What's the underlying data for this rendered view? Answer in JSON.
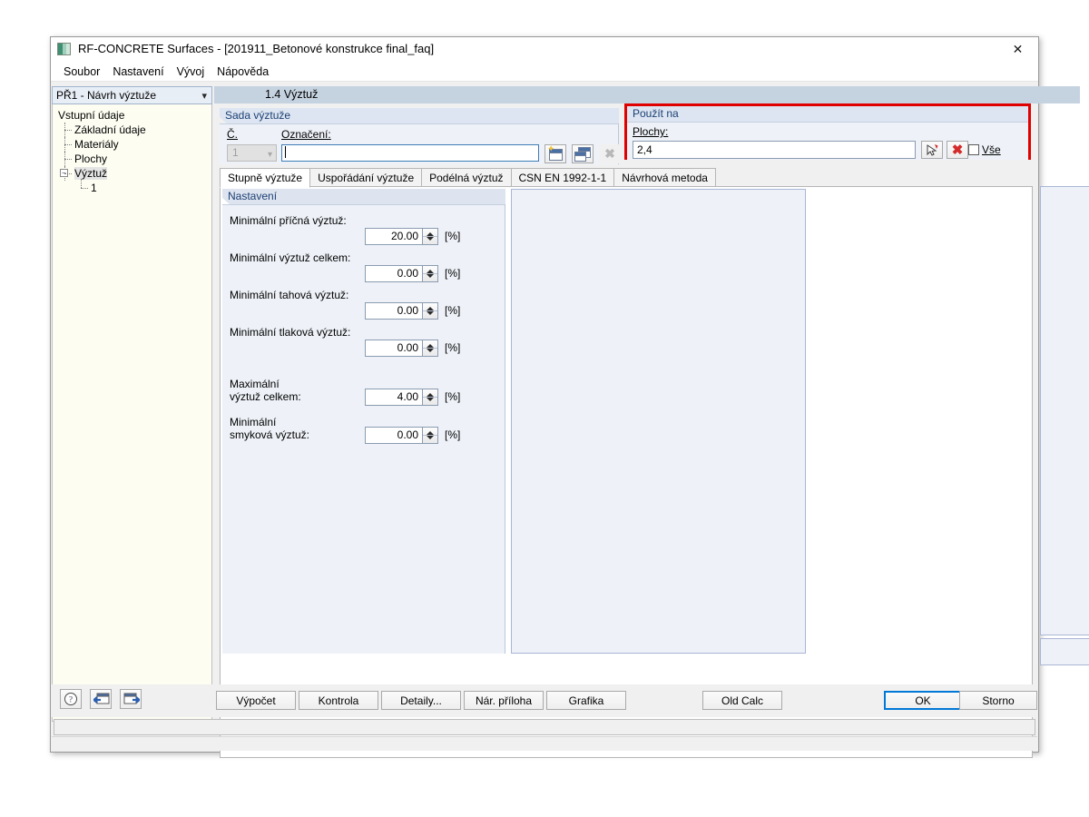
{
  "window": {
    "title": "RF-CONCRETE Surfaces - [201911_Betonové konstrukce final_faq]",
    "close_label": "✕",
    "app_icon": "app-window-icon"
  },
  "menubar": {
    "items": [
      {
        "label": "Soubor"
      },
      {
        "label": "Nastavení"
      },
      {
        "label": "Vývoj"
      },
      {
        "label": "Nápověda"
      }
    ]
  },
  "sidebar": {
    "combo_value": "PŘ1 - Návrh výztuže",
    "tree": [
      {
        "label": "Vstupní údaje",
        "level": 0
      },
      {
        "label": "Základní údaje",
        "level": 1
      },
      {
        "label": "Materiály",
        "level": 1
      },
      {
        "label": "Plochy",
        "level": 1
      },
      {
        "label": "Výztuž",
        "level": 1,
        "expander": "−",
        "selected": true
      },
      {
        "label": "1",
        "level": 2
      }
    ]
  },
  "page": {
    "header": "1.4 Výztuž"
  },
  "reinforcement_set": {
    "group_title": "Sada výztuže",
    "no_label": "Č.",
    "no_value": "1",
    "designation_label": "Označení:",
    "designation_value": "",
    "buttons": {
      "new": "new-set-button",
      "copy": "copy-set-button",
      "delete": "delete-set-button"
    }
  },
  "apply_to": {
    "group_title": "Použít na",
    "surfaces_label": "Plochy:",
    "surfaces_value": "2,4",
    "pick_button": "pick-surfaces-button",
    "clear_button": "clear-surfaces-button",
    "all_checkbox_label": "Vše",
    "all_checked": false,
    "highlight_color": "#e00000"
  },
  "tabs": [
    {
      "label": "Stupně výztuže",
      "active": true
    },
    {
      "label": "Uspořádání výztuže",
      "active": false
    },
    {
      "label": "Podélná výztuž",
      "active": false
    },
    {
      "label": "CSN EN 1992-1-1",
      "active": false
    },
    {
      "label": "Návrhová metoda",
      "active": false
    }
  ],
  "settings": {
    "group_title": "Nastavení",
    "rows": [
      {
        "label": "Minimální příčná výztuž:",
        "value": "20.00",
        "unit": "[%]"
      },
      {
        "label": "Minimální výztuž celkem:",
        "value": "0.00",
        "unit": "[%]"
      },
      {
        "label": "Minimální tahová výztuž:",
        "value": "0.00",
        "unit": "[%]"
      },
      {
        "label": "Minimální tlaková výztuž:",
        "value": "0.00",
        "unit": "[%]"
      },
      {
        "label": "Maximální\nvýztuž celkem:",
        "value": "4.00",
        "unit": "[%]"
      },
      {
        "label": "Minimální\nsmyková výztuž:",
        "value": "0.00",
        "unit": "[%]"
      }
    ],
    "row0_label": "Minimální příčná výztuž:",
    "row0_value": "20.00",
    "row0_unit": "[%]",
    "row1_label": "Minimální výztuž celkem:",
    "row1_value": "0.00",
    "row1_unit": "[%]",
    "row2_label": "Minimální tahová výztuž:",
    "row2_value": "0.00",
    "row2_unit": "[%]",
    "row3_label": "Minimální tlaková výztuž:",
    "row3_value": "0.00",
    "row3_unit": "[%]",
    "row4_label_line1": "Maximální",
    "row4_label_line2": "výztuž celkem:",
    "row4_value": "4.00",
    "row4_unit": "[%]",
    "row5_label_line1": "Minimální",
    "row5_label_line2": "smyková výztuž:",
    "row5_value": "0.00",
    "row5_unit": "[%]"
  },
  "bottom_bar": {
    "help_button": "help-button",
    "prev_button": "previous-button",
    "next_button": "next-button",
    "buttons": [
      {
        "label": "Výpočet"
      },
      {
        "label": "Kontrola"
      },
      {
        "label": "Detaily..."
      },
      {
        "label": "Nár. příloha"
      },
      {
        "label": "Grafika"
      },
      {
        "label": "Old Calc"
      }
    ],
    "ok_label": "OK",
    "cancel_label": "Storno"
  },
  "status_bar": {
    "text": ""
  }
}
